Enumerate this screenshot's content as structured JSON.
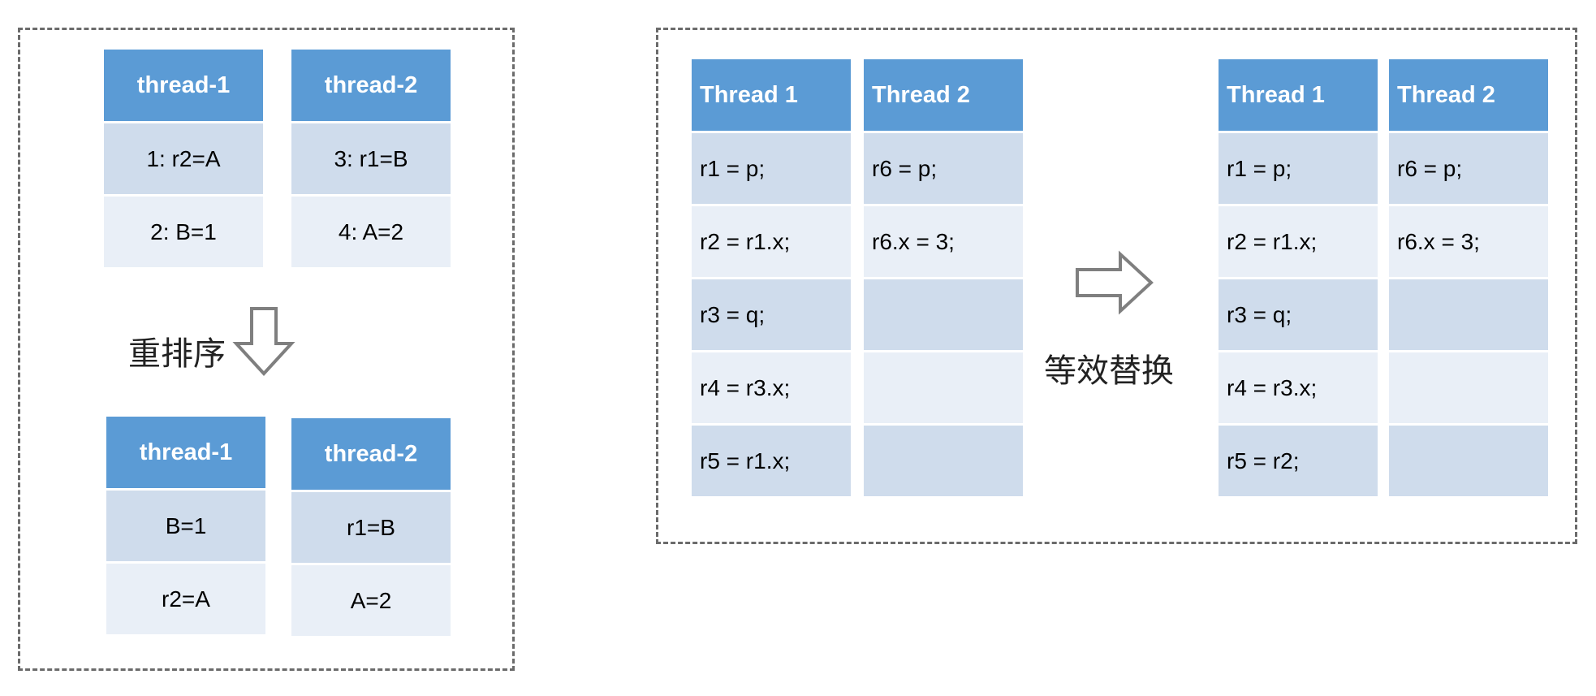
{
  "left_panel": {
    "before": [
      {
        "header": "thread-1",
        "cells": [
          "1: r2=A",
          "2: B=1"
        ]
      },
      {
        "header": "thread-2",
        "cells": [
          "3: r1=B",
          "4: A=2"
        ]
      }
    ],
    "reorder_label": "重排序",
    "after": [
      {
        "header": "thread-1",
        "cells": [
          "B=1",
          "r2=A"
        ]
      },
      {
        "header": "thread-2",
        "cells": [
          "r1=B",
          "A=2"
        ]
      }
    ]
  },
  "right_panel": {
    "before": [
      {
        "header": "Thread 1",
        "cells": [
          "r1 = p;",
          "r2 = r1.x;",
          "r3 = q;",
          "r4 = r3.x;",
          "r5 = r1.x;"
        ]
      },
      {
        "header": "Thread 2",
        "cells": [
          "r6 = p;",
          "r6.x = 3;",
          "",
          "",
          ""
        ]
      }
    ],
    "substitution_label": "等效替换",
    "after": [
      {
        "header": "Thread 1",
        "cells": [
          "r1 = p;",
          "r2 = r1.x;",
          "r3 = q;",
          "r4 = r3.x;",
          "r5 = r2;"
        ]
      },
      {
        "header": "Thread 2",
        "cells": [
          "r6 = p;",
          "r6.x = 3;",
          "",
          "",
          ""
        ]
      }
    ]
  },
  "colors": {
    "header_fill": "#5b9bd5",
    "cell_dark": "#cfdcec",
    "cell_light": "#e9eff7",
    "dashed_border": "#6b6b6b",
    "arrow_stroke": "#7f7f7f"
  }
}
